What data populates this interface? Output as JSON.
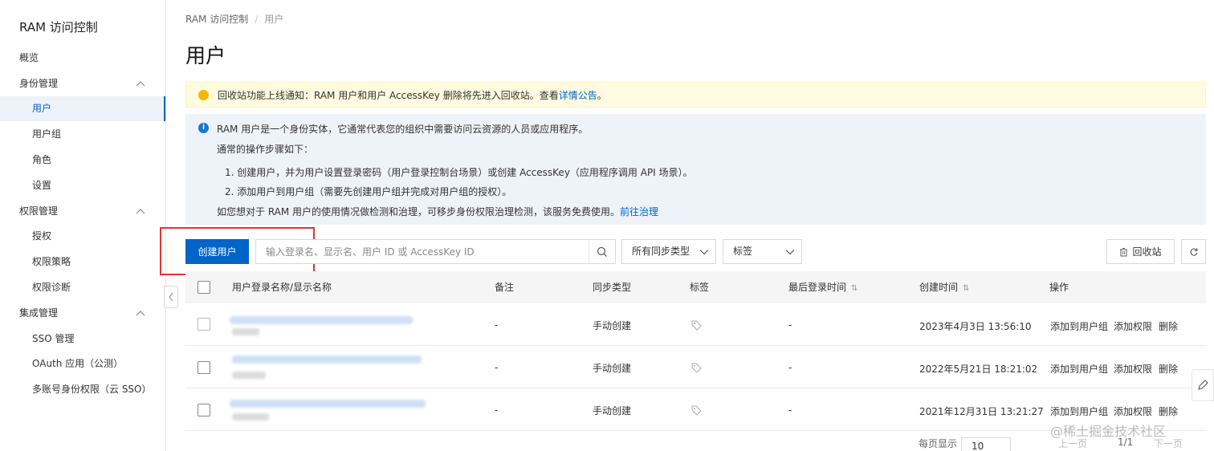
{
  "sidebar": {
    "title": "RAM 访问控制",
    "items": [
      {
        "label": "概览"
      },
      {
        "label": "身份管理"
      },
      {
        "label": "用户"
      },
      {
        "label": "用户组"
      },
      {
        "label": "角色"
      },
      {
        "label": "设置"
      },
      {
        "label": "权限管理"
      },
      {
        "label": "授权"
      },
      {
        "label": "权限策略"
      },
      {
        "label": "权限诊断"
      },
      {
        "label": "集成管理"
      },
      {
        "label": "SSO 管理"
      },
      {
        "label": "OAuth 应用（公测）"
      },
      {
        "label": "多账号身份权限（云 SSO）"
      }
    ]
  },
  "breadcrumb": {
    "root": "RAM 访问控制",
    "separator": "/",
    "current": "用户"
  },
  "page_title": "用户",
  "notice_warn": {
    "text": "回收站功能上线通知：RAM 用户和用户 AccessKey 删除将先进入回收站。查看",
    "link": "详情公告",
    "tail": "。"
  },
  "notice_info": {
    "line1": "RAM 用户是一个身份实体，它通常代表您的组织中需要访问云资源的人员或应用程序。",
    "line2": "通常的操作步骤如下：",
    "step1": "1. 创建用户，并为用户设置登录密码（用户登录控制台场景）或创建 AccessKey（应用程序调用 API 场景）。",
    "step2": "2. 添加用户到用户组（需要先创建用户组并完成对用户组的授权）。",
    "line3": "如您想对于 RAM 用户的使用情况做检测和治理，可移步身份权限治理检测，该服务免费使用。",
    "line3_link": "前往治理"
  },
  "toolbar": {
    "create_label": "创建用户",
    "search_placeholder": "输入登录名、显示名、用户 ID 或 AccessKey ID",
    "sync_select": "所有同步类型",
    "tag_select": "标签",
    "recycle_label": "回收站"
  },
  "table": {
    "headers": [
      "用户登录名称/显示名称",
      "备注",
      "同步类型",
      "标签",
      "最后登录时间",
      "创建时间",
      "操作"
    ],
    "rows": [
      {
        "note": "-",
        "sync": "手动创建",
        "last_login": "-",
        "created": "2023年4月3日 13:56:10"
      },
      {
        "note": "-",
        "sync": "手动创建",
        "last_login": "-",
        "created": "2022年5月21日 18:21:02"
      },
      {
        "note": "-",
        "sync": "手动创建",
        "last_login": "-",
        "created": "2021年12月31日 13:21:27"
      }
    ],
    "actions": [
      "添加到用户组",
      "添加权限",
      "删除"
    ]
  },
  "pager": {
    "per_page_label": "每页显示",
    "per_page": "10",
    "prev": "上一页",
    "page": "1/1",
    "next": "下一页"
  },
  "watermark": "@稀土掘金技术社区",
  "colors": {
    "primary": "#0064c8",
    "warn_bg": "#fffbe0",
    "info_bg": "#eef2f9",
    "highlight": "#e53333"
  }
}
